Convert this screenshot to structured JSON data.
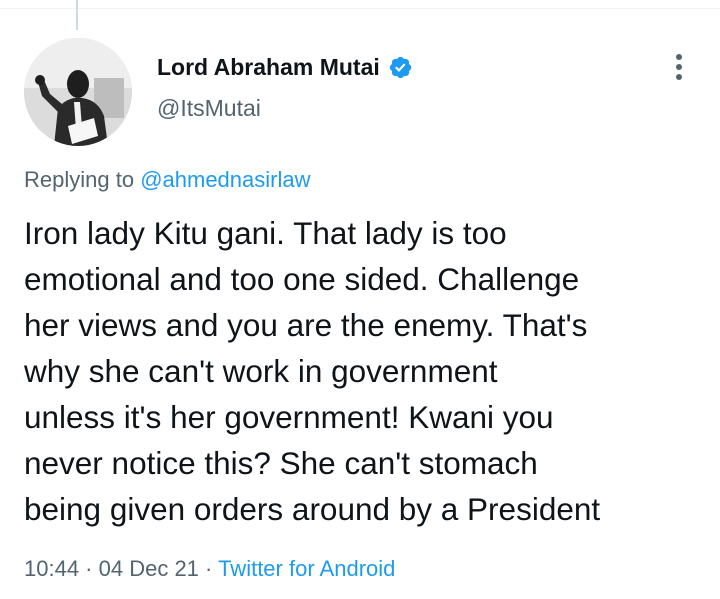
{
  "tweet": {
    "author": {
      "display_name": "Lord Abraham Mutai",
      "handle": "@ItsMutai",
      "verified": true,
      "avatar_icon": "profile-photo-man-speaking"
    },
    "replying_prefix": "Replying to ",
    "replying_to": "@ahmednasirlaw",
    "text": "Iron lady Kitu gani. That lady is too\nemotional and too one sided. Challenge\nher views and you are the enemy. That's\nwhy she can't work in government\nunless it's her government! Kwani you\nnever notice this? She can't stomach\nbeing given orders around by a President",
    "time": "10:44",
    "separator": " · ",
    "date": "04 Dec 21",
    "source": "Twitter for Android"
  },
  "colors": {
    "link": "#1d9bf0",
    "secondary_text": "#536471",
    "primary_text": "#0f1419",
    "verified_badge": "#1d9bf0"
  },
  "icons": {
    "more": "more-vertical-icon",
    "verified": "verified-badge-icon"
  }
}
